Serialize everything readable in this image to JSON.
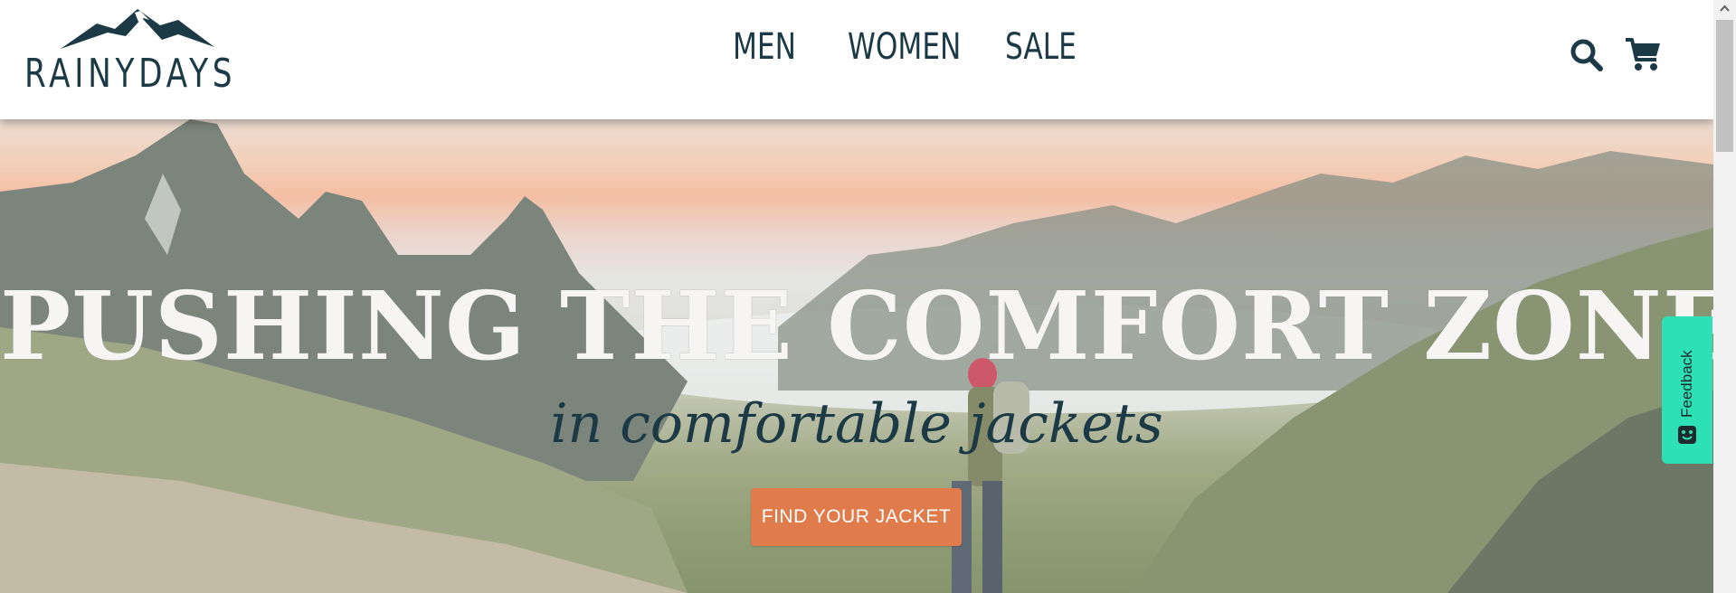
{
  "brand": {
    "name": "RAINYDAYS"
  },
  "nav": {
    "items": [
      {
        "label": "MEN"
      },
      {
        "label": "WOMEN"
      },
      {
        "label": "SALE"
      }
    ]
  },
  "header": {
    "icons": {
      "search": "search-icon",
      "cart": "cart-icon"
    }
  },
  "hero": {
    "headline": "PUSHING THE COMFORT ZONE",
    "subheadline": "in comfortable jackets",
    "cta_label": "FIND YOUR JACKET"
  },
  "feedback": {
    "label": "Feedback",
    "icon": "smiley-icon"
  },
  "colors": {
    "brand": "#1c3a45",
    "cta": "#e07b4b",
    "feedback": "#2de0b5",
    "headline_text": "#f6f5f3"
  }
}
